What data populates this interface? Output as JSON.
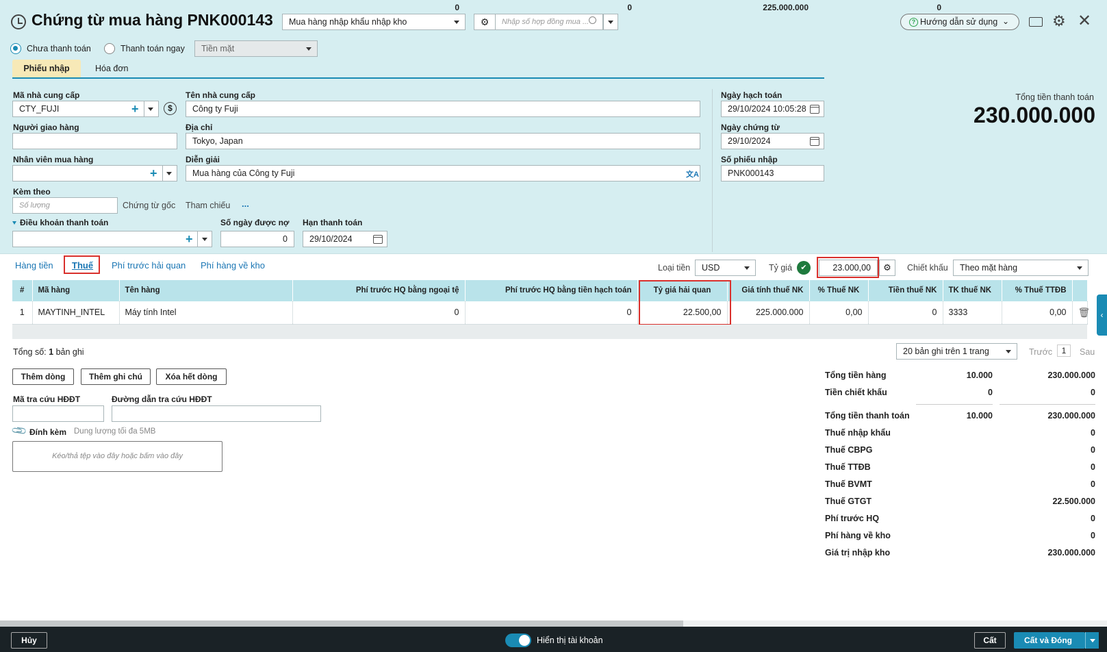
{
  "header": {
    "title": "Chứng từ mua hàng PNK000143",
    "type_select": "Mua hàng nhập khẩu nhập kho",
    "contract_placeholder": "Nhập số hợp đồng mua ...",
    "help_label": "Hướng dẫn sử dụng"
  },
  "payment": {
    "option_unpaid": "Chưa thanh toán",
    "option_paid_now": "Thanh toán ngay",
    "method": "Tiền mặt"
  },
  "tabs": {
    "receipt": "Phiếu nhập",
    "invoice": "Hóa đơn"
  },
  "form": {
    "supplier_code_label": "Mã nhà cung cấp",
    "supplier_code": "CTY_FUJI",
    "supplier_name_label": "Tên nhà cung cấp",
    "supplier_name": "Công ty Fuji",
    "deliverer_label": "Người giao hàng",
    "address_label": "Địa chỉ",
    "address": "Tokyo, Japan",
    "buyer_label": "Nhân viên mua hàng",
    "description_label": "Diễn giải",
    "description": "Mua hàng của Công ty Fuji",
    "attach_label": "Kèm theo",
    "attach_placeholder": "Số lượng",
    "original_docs": "Chứng từ gốc",
    "reference_label": "Tham chiếu",
    "reference_more": "...",
    "terms_label": "Điều khoản thanh toán",
    "credit_days_label": "Số ngày được nợ",
    "credit_days": "0",
    "due_date_label": "Hạn thanh toán",
    "due_date": "29/10/2024",
    "posting_date_label": "Ngày hạch toán",
    "posting_date": "29/10/2024 10:05:28",
    "doc_date_label": "Ngày chứng từ",
    "doc_date": "29/10/2024",
    "receipt_no_label": "Số phiếu nhập",
    "receipt_no": "PNK000143"
  },
  "total": {
    "label": "Tổng tiền thanh toán",
    "value": "230.000.000"
  },
  "subtabs": {
    "goods": "Hàng tiền",
    "tax": "Thuế",
    "pre_customs": "Phí trước hải quan",
    "to_warehouse": "Phí hàng về kho"
  },
  "currency": {
    "label": "Loại tiền",
    "value": "USD",
    "rate_label": "Tỷ giá",
    "rate": "23.000,00",
    "discount_label": "Chiết khấu",
    "discount": "Theo mặt hàng"
  },
  "table": {
    "headers": [
      "#",
      "Mã hàng",
      "Tên hàng",
      "Phí trước HQ bằng ngoại tệ",
      "Phí trước HQ bằng tiền hạch toán",
      "Tỷ giá hải quan",
      "Giá tính thuế NK",
      "% Thuế NK",
      "Tiền thuế NK",
      "TK thuế NK",
      "% Thuế TTĐB"
    ],
    "row": [
      "1",
      "MAYTINH_INTEL",
      "Máy tính Intel",
      "0",
      "0",
      "22.500,00",
      "225.000.000",
      "0,00",
      "0",
      "3333",
      "0,00"
    ],
    "totals": {
      "pre_foreign": "0",
      "pre_local": "0",
      "taxable": "225.000.000",
      "tax_nk": "0"
    }
  },
  "record_count": {
    "prefix": "Tổng số:",
    "count": "1",
    "suffix": "bản ghi"
  },
  "pager": {
    "page_size": "20 bản ghi trên 1 trang",
    "prev": "Trước",
    "page": "1",
    "next": "Sau"
  },
  "buttons": {
    "add_row": "Thêm dòng",
    "add_note": "Thêm ghi chú",
    "delete_all": "Xóa hết dòng"
  },
  "einvoice": {
    "code_label": "Mã tra cứu HĐĐT",
    "link_label": "Đường dẫn tra cứu HĐĐT"
  },
  "attachment": {
    "label": "Đính kèm",
    "limit": "Dung lượng tối đa 5MB",
    "drop": "Kéo/thả tệp vào đây hoặc bấm vào đây"
  },
  "summary": [
    {
      "label": "Tổng tiền hàng",
      "v1": "10.000",
      "v2": "230.000.000"
    },
    {
      "label": "Tiền chiết khấu",
      "v1": "0",
      "v2": "0"
    },
    {
      "label": "Tổng tiền thanh toán",
      "v1": "10.000",
      "v2": "230.000.000"
    },
    {
      "label": "Thuế nhập khẩu",
      "v1": "",
      "v2": "0"
    },
    {
      "label": "Thuế CBPG",
      "v1": "",
      "v2": "0"
    },
    {
      "label": "Thuế TTĐB",
      "v1": "",
      "v2": "0"
    },
    {
      "label": "Thuế BVMT",
      "v1": "",
      "v2": "0"
    },
    {
      "label": "Thuế GTGT",
      "v1": "",
      "v2": "22.500.000"
    },
    {
      "label": "Phí trước HQ",
      "v1": "",
      "v2": "0"
    },
    {
      "label": "Phí hàng về kho",
      "v1": "",
      "v2": "0"
    },
    {
      "label": "Giá trị nhập kho",
      "v1": "",
      "v2": "230.000.000"
    }
  ],
  "footer": {
    "cancel": "Hủy",
    "show_accounts": "Hiển thị tài khoản",
    "save": "Cất",
    "save_close": "Cất và Đóng"
  },
  "colors": {
    "header_bg": "#d6eef1",
    "accent": "#1a8bb4",
    "highlight": "#d9302c",
    "footer_bg": "#1a2226",
    "primary_btn": "#1a8bb4"
  }
}
